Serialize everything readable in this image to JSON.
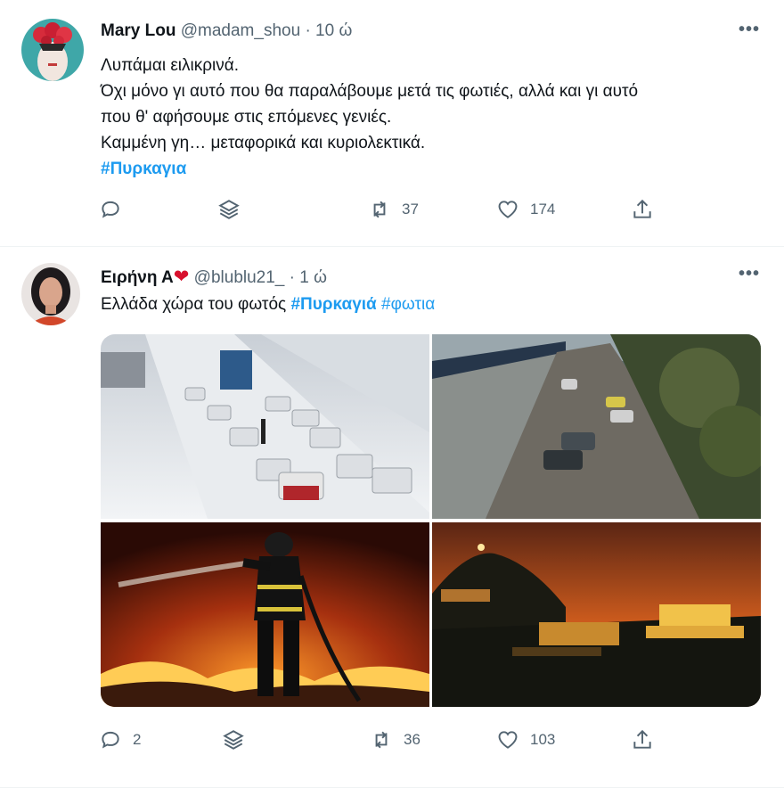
{
  "tweets": [
    {
      "name": "Mary Lou",
      "handle": "@madam_shou",
      "sep": "·",
      "time": "10 ώ",
      "lines": [
        "Λυπάμαι ειλικρινά.",
        "Όχι μόνο γι αυτό που θα παραλάβουμε μετά τις φωτιές, αλλά και γι αυτό",
        "που θ' αφήσουμε στις επόμενες γενιές.",
        "Καμμένη γη… μεταφορικά και κυριολεκτικά."
      ],
      "hashtag": "#Πυρκαγια",
      "replies": "",
      "retweets": "37",
      "likes": "174"
    },
    {
      "name": "Ειρήνη Α",
      "heart": "❤",
      "handle": "@blublu21_",
      "sep": "·",
      "time": "1 ώ",
      "text": "Ελλάδα χώρα του φωτός",
      "hashtag1": "#Πυρκαγιά",
      "hashtag2": "#φωτια",
      "replies": "2",
      "retweets": "36",
      "likes": "103"
    }
  ],
  "more_label": "•••",
  "colors": {
    "link": "#1d9bf0",
    "muted": "#536471",
    "text": "#0f1419",
    "heart": "#d8112e"
  }
}
